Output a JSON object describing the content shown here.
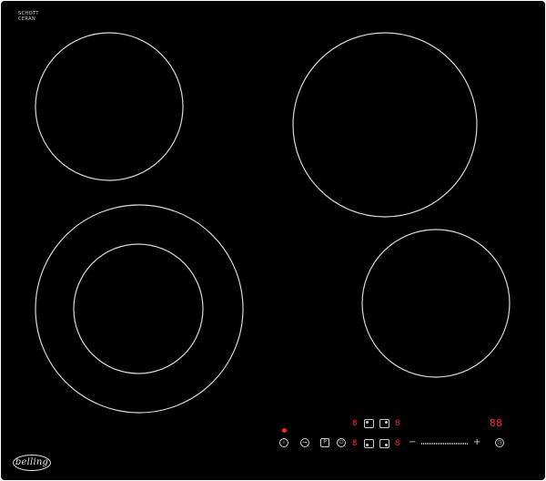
{
  "product": {
    "glass_brand_line1": "SCHOTT",
    "glass_brand_line2": "CERAN",
    "logo_text": "belling"
  },
  "controls": {
    "zone_digits_top": [
      "8",
      "8"
    ],
    "zone_digits_bottom": [
      "8",
      "8"
    ],
    "timer_display": "88",
    "minus_symbol": "−",
    "plus_symbol": "+",
    "icons": {
      "info": "info-icon",
      "lock": "key-lock-icon",
      "boost": "boost-icon",
      "power": "power-icon",
      "timer": "clock-icon"
    }
  },
  "colors": {
    "glass": "#000000",
    "zone_outline": "#d9d9d9",
    "indicator": "#ff2a2a"
  }
}
